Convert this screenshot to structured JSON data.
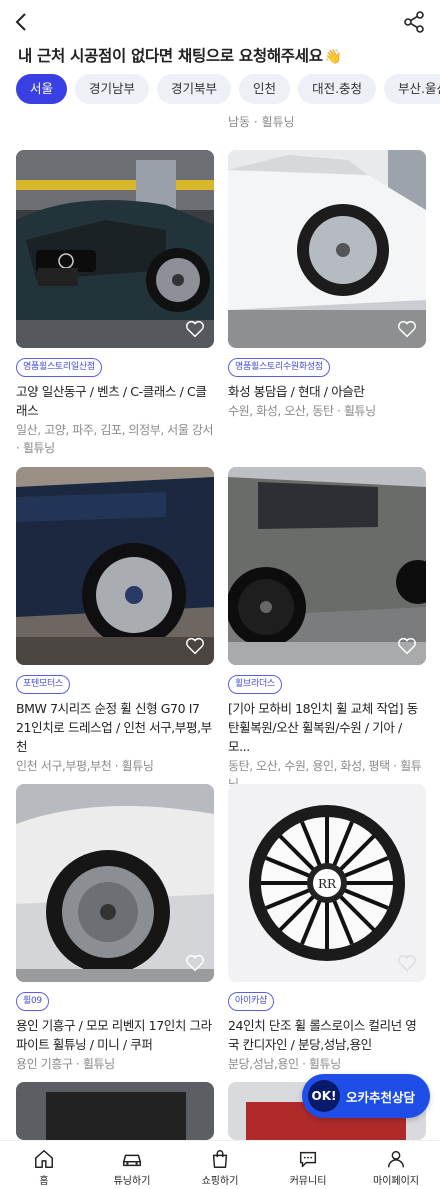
{
  "headline": {
    "text": "내 근처 시공점이 없다면 채팅으로 요청해주세요",
    "emoji": "👋"
  },
  "regions": [
    {
      "label": "서울",
      "active": true
    },
    {
      "label": "경기남부",
      "active": false
    },
    {
      "label": "경기북부",
      "active": false
    },
    {
      "label": "인천",
      "active": false
    },
    {
      "label": "대전.충청",
      "active": false
    },
    {
      "label": "부산.울산.경남",
      "active": false
    }
  ],
  "cut_top": {
    "meta": "남동 · 휠튜닝"
  },
  "cards": [
    {
      "badge": "명품휠스토리일산점",
      "title": "고양 일산동구 / 벤츠 / C-클래스 / C클래스",
      "meta": "일산, 고양, 파주, 김포, 의정부, 서울 강서 · 휠튜닝"
    },
    {
      "badge": "명품휠스토리수원화성점",
      "title": "화성 봉담읍 / 현대 / 아슬란",
      "meta": "수원, 화성, 오산, 동탄 · 휠튜닝"
    },
    {
      "badge": "포텐모터스",
      "title": "BMW 7시리즈 순정 휠 신형 G70 I7 21인치로 드레스업 / 인천 서구,부평,부천",
      "meta": "인천 서구,부평,부천 · 휠튜닝"
    },
    {
      "badge": "휠브라더스",
      "title": "[기아 모하비 18인치 휠 교체 작업] 동탄휠복원/오산 휠복원/수원 / 기아 / 모...",
      "meta": "동탄, 오산, 수원, 용인, 화성, 평택 · 휠튜닝"
    },
    {
      "badge": "휠09",
      "title": "용인 기흥구 / 모모 리벤지 17인치 그라파이트 휠튜닝 / 미니 / 쿠퍼",
      "meta": "용인 기흥구 · 휠튜닝"
    },
    {
      "badge": "아이카샵",
      "title": "24인치 단조 휠 롤스로이스 컬리넌 영국 칸디자인 / 분당,성남,용인",
      "meta": "분당,성남,용인 · 휠튜닝"
    }
  ],
  "fab": {
    "ok": "OK!",
    "label": "오카추천상담"
  },
  "tabs": [
    {
      "label": "홈",
      "icon": "home-icon"
    },
    {
      "label": "튜닝하기",
      "icon": "car-icon"
    },
    {
      "label": "쇼핑하기",
      "icon": "shopping-bag-icon"
    },
    {
      "label": "커뮤니티",
      "icon": "chat-bubble-icon"
    },
    {
      "label": "마이페이지",
      "icon": "user-icon"
    }
  ],
  "colors": {
    "accent": "#3a3fe3",
    "fab": "#1e4de8",
    "badge": "#5b5fe8"
  }
}
